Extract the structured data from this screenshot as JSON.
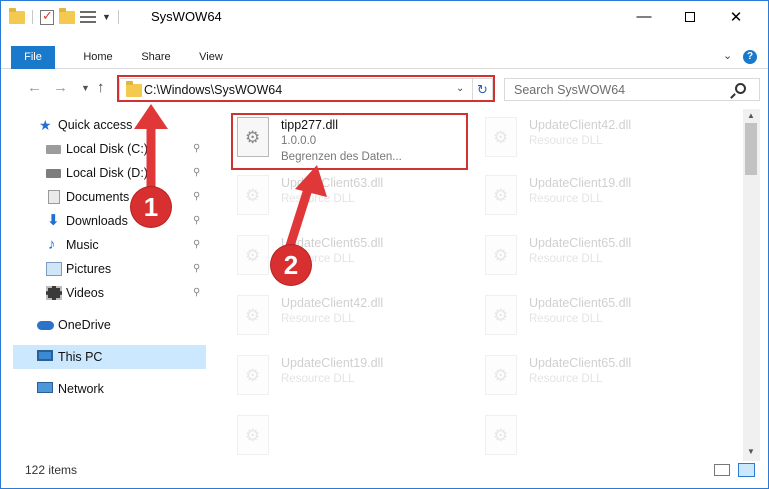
{
  "window": {
    "title": "SysWOW64",
    "controls": {
      "minimize": "—",
      "maximize": "",
      "close": "✕"
    }
  },
  "ribbon": {
    "tabs": [
      "File",
      "Home",
      "Share",
      "View"
    ],
    "expand_glyph": "⌄",
    "help_glyph": "?"
  },
  "nav": {
    "back_glyph": "←",
    "forward_glyph": "→",
    "recent_glyph": "⌄",
    "up_glyph": "↑"
  },
  "address": {
    "path": "C:\\Windows\\SysWOW64",
    "dropdown_glyph": "⌄",
    "refresh_glyph": "↻"
  },
  "search": {
    "placeholder": "Search SysWOW64"
  },
  "sidebar": {
    "items": [
      {
        "label": "Quick access",
        "icon": "star-icon",
        "pinned": false
      },
      {
        "label": "Local Disk (C:)",
        "icon": "drive-icon",
        "pinned": true
      },
      {
        "label": "Local Disk (D:)",
        "icon": "drive-icon",
        "pinned": true
      },
      {
        "label": "Documents",
        "icon": "documents-icon",
        "pinned": true
      },
      {
        "label": "Downloads",
        "icon": "downloads-icon",
        "pinned": true
      },
      {
        "label": "Music",
        "icon": "music-icon",
        "pinned": true
      },
      {
        "label": "Pictures",
        "icon": "pictures-icon",
        "pinned": true
      },
      {
        "label": "Videos",
        "icon": "videos-icon",
        "pinned": true
      },
      {
        "label": "OneDrive",
        "icon": "onedrive-icon",
        "pinned": false
      },
      {
        "label": "This PC",
        "icon": "this-pc-icon",
        "pinned": false,
        "selected": true
      },
      {
        "label": "Network",
        "icon": "network-icon",
        "pinned": false
      }
    ],
    "pin_glyph": "📌"
  },
  "files": {
    "highlighted": {
      "name": "tipp277.dll",
      "version": "1.0.0.0",
      "description": "Begrenzen des Daten..."
    },
    "faded": [
      {
        "name": "UpdateClient42.dll",
        "type": "Resource DLL"
      },
      {
        "name": "UpdateClient63.dll",
        "type": "Resource DLL"
      },
      {
        "name": "UpdateClient19.dll",
        "type": "Resource DLL"
      },
      {
        "name": "UpdateClient65.dll",
        "type": "Resource DLL"
      },
      {
        "name": "UpdateClient65.dll",
        "type": "Resource DLL"
      },
      {
        "name": "UpdateClient42.dll",
        "type": "Resource DLL"
      },
      {
        "name": "UpdateClient65.dll",
        "type": "Resource DLL"
      },
      {
        "name": "UpdateClient19.dll",
        "type": "Resource DLL"
      },
      {
        "name": "UpdateClient65.dll",
        "type": "Resource DLL"
      }
    ]
  },
  "status": {
    "item_count": "122 items"
  },
  "annotations": {
    "step1": "1",
    "step2": "2",
    "highlight_color": "#d03232"
  },
  "colors": {
    "accent": "#1979ca",
    "selection": "#cce8ff"
  }
}
